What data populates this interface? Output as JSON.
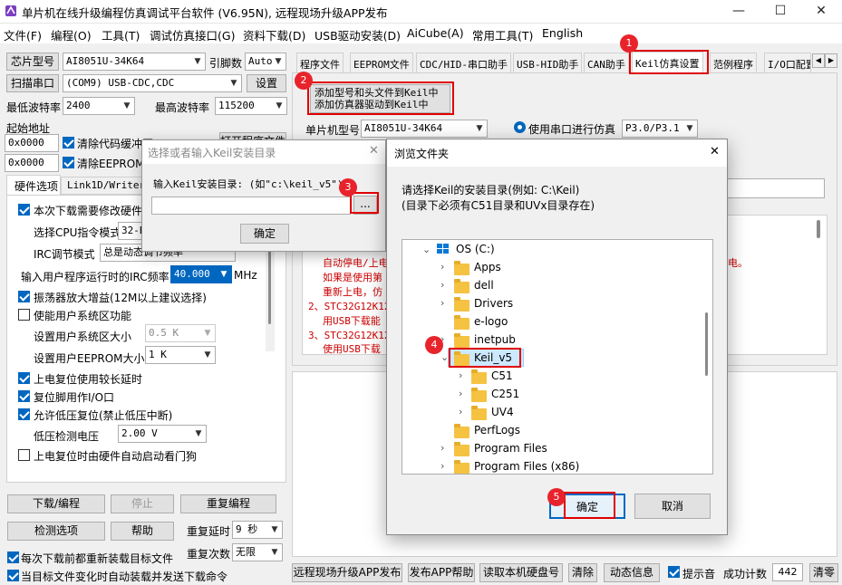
{
  "window": {
    "title": "单片机在线升级编程仿真调试平台软件 (V6.95N), 远程现场升级APP发布",
    "minimize": "—",
    "maximize": "☐",
    "close": "✕"
  },
  "menu": [
    "文件(F)",
    "编程(O)",
    "工具(T)",
    "调试仿真接口(G)",
    "资料下载(D)",
    "USB驱动安装(D)",
    "AiCube(A)",
    "常用工具(T)",
    "English"
  ],
  "left": {
    "chip_label": "芯片型号",
    "chip_value": "AI8051U-34K64",
    "pins_label": "引脚数",
    "pins_value": "Auto",
    "scan_label": "扫描串口",
    "port_value": "(COM9) USB-CDC,CDC",
    "settings_btn": "设置",
    "min_baud_label": "最低波特率",
    "min_baud": "2400",
    "max_baud_label": "最高波特率",
    "max_baud": "115200",
    "start_addr_label": "起始地址",
    "addr1": "0x0000",
    "addr2": "0x0000",
    "clear_code": "清除代码缓冲区",
    "clear_eeprom": "清除EEPROM缓冲区",
    "open_prog_btn": "打开程序文件",
    "hw_tab": "硬件选项",
    "link_tab": "Link1D/Writer",
    "opt_modify": "本次下载需要修改硬件选项",
    "opt_cpu_label": "选择CPU指令模式",
    "opt_cpu_value": "32-Bit",
    "opt_irc_label": "IRC调节模式",
    "opt_irc_value": "总是动态调节频率",
    "opt_freq_label": "输入用户程序运行时的IRC频率",
    "opt_freq_value": "40.000",
    "opt_freq_unit": "MHz",
    "opt_osc": "振荡器放大增益(12M以上建议选择)",
    "opt_sysarea": "使能用户系统区功能",
    "opt_sys_size_label": "设置用户系统区大小",
    "opt_sys_size": "0.5 K",
    "opt_eep_size_label": "设置用户EEPROM大小",
    "opt_eep_size": "1   K",
    "opt_poweron_delay": "上电复位使用较长延时",
    "opt_reset_io": "复位脚用作I/O口",
    "opt_lowvolt": "允许低压复位(禁止低压中断)",
    "opt_lowvolt_label": "低压检测电压",
    "opt_lowvolt_value": "2.00 V",
    "opt_watchdog": "上电复位时由硬件自动启动看门狗",
    "download_btn": "下载/编程",
    "stop_btn": "停止",
    "reprogram_btn": "重复编程",
    "check_btn": "检测选项",
    "help_btn": "帮助",
    "repeat_delay_label": "重复延时",
    "repeat_delay": "9 秒",
    "repeat_count_label": "重复次数",
    "repeat_count": "无限",
    "reload_each": "每次下载前都重新装载目标文件",
    "reload_change": "当目标文件变化时自动装载并发送下载命令"
  },
  "tabs": [
    "程序文件",
    "EEPROM文件",
    "CDC/HID-串口助手",
    "USB-HID助手",
    "CAN助手",
    "Keil仿真设置",
    "范例程序",
    "I/O口配置"
  ],
  "keil": {
    "add_btn_line1": "添加型号和头文件到Keil中",
    "add_btn_line2": "添加仿真器驱动到Keil中",
    "chip_label": "单片机型号",
    "chip_value": "AI8051U-34K64",
    "serial_radio": "使用串口进行仿真",
    "serial_pins": "P3.0/P3.1",
    "red_lines": [
      "自动停电/上电",
      "如果是使用第",
      "重新上电，仿",
      "2、STC32G12K128",
      "用USB下载能",
      "3、STC32G12K128",
      "使用USB下载"
    ],
    "red_right": "电。"
  },
  "bottom": {
    "remote_btn": "远程现场升级APP发布",
    "publish_help": "发布APP帮助",
    "read_disk": "读取本机硬盘号",
    "clear": "清除",
    "dyn_info": "动态信息",
    "beep": "提示音",
    "success_label": "成功计数",
    "success_count": "442",
    "clear_count": "清零"
  },
  "dlg_keil": {
    "title": "选择或者输入Keil安装目录",
    "prompt": "输入Keil安装目录: (如\"c:\\keil_v5\")",
    "browse": "...",
    "ok": "确定",
    "input_value": ""
  },
  "dlg_browse": {
    "title": "浏览文件夹",
    "line1": "请选择Keil的安装目录(例如: C:\\Keil)",
    "line2": "(目录下必须有C51目录和UVx目录存在)",
    "tree": [
      {
        "label": "OS (C:)"
      },
      {
        "label": "Apps"
      },
      {
        "label": "dell"
      },
      {
        "label": "Drivers"
      },
      {
        "label": "e-logo"
      },
      {
        "label": "inetpub"
      },
      {
        "label": "Keil_v5"
      },
      {
        "label": "C51"
      },
      {
        "label": "C251"
      },
      {
        "label": "UV4"
      },
      {
        "label": "PerfLogs"
      },
      {
        "label": "Program Files"
      },
      {
        "label": "Program Files (x86)"
      }
    ],
    "ok": "确定",
    "cancel": "取消"
  },
  "badges": [
    "1",
    "2",
    "3",
    "4",
    "5"
  ],
  "colors": {
    "accent": "#0067c0",
    "annotation": "#e00000"
  }
}
